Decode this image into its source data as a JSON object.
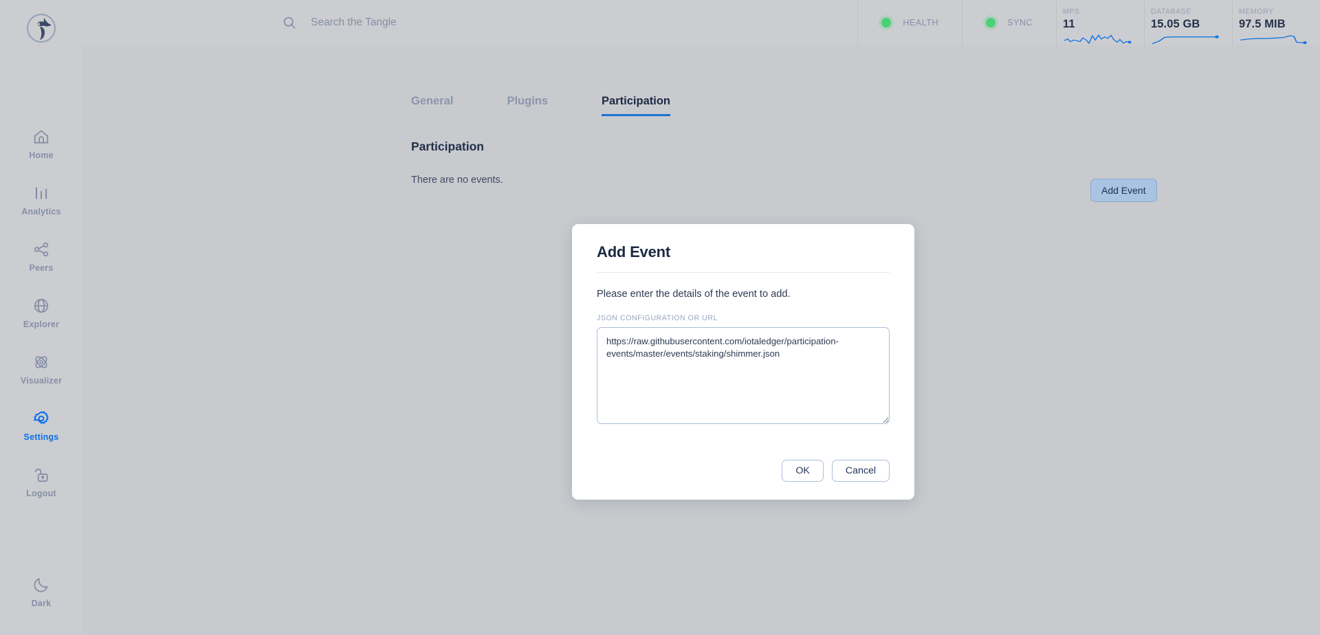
{
  "app": {
    "logo_icon": "hornet-logo-icon",
    "theme_mode_label": "Dark"
  },
  "sidebar": {
    "items": [
      {
        "label": "Home",
        "icon": "home-icon",
        "active": false
      },
      {
        "label": "Analytics",
        "icon": "bar-chart-icon",
        "active": false
      },
      {
        "label": "Peers",
        "icon": "peers-icon",
        "active": false
      },
      {
        "label": "Explorer",
        "icon": "globe-icon",
        "active": false
      },
      {
        "label": "Visualizer",
        "icon": "atom-icon",
        "active": false
      },
      {
        "label": "Settings",
        "icon": "gear-icon",
        "active": true
      },
      {
        "label": "Logout",
        "icon": "unlock-icon",
        "active": false
      }
    ],
    "theme_toggle": {
      "label": "Dark",
      "icon": "moon-icon"
    }
  },
  "header": {
    "search": {
      "icon": "search-icon",
      "placeholder": "Search the Tangle",
      "value": ""
    },
    "status": [
      {
        "label": "HEALTH",
        "icon": "status-dot-icon",
        "color": "#4cd076"
      },
      {
        "label": "SYNC",
        "icon": "status-dot-icon",
        "color": "#4cd076"
      }
    ],
    "metrics": [
      {
        "label": "MPS",
        "value": "11",
        "spark": "mps-sparkline"
      },
      {
        "label": "DATABASE",
        "value": "15.05 GB",
        "spark": "database-sparkline"
      },
      {
        "label": "MEMORY",
        "value": "97.5 MIB",
        "spark": "memory-sparkline"
      }
    ]
  },
  "main": {
    "tabs": [
      {
        "label": "General",
        "active": false
      },
      {
        "label": "Plugins",
        "active": false
      },
      {
        "label": "Participation",
        "active": true
      }
    ],
    "panel": {
      "title": "Participation",
      "empty_text": "There are no events.",
      "add_event_label": "Add Event"
    }
  },
  "dialog": {
    "title": "Add Event",
    "description": "Please enter the details of the event to add.",
    "field_label": "JSON CONFIGURATION OR URL",
    "field_value": "https://raw.githubusercontent.com/iotaledger/participation-events/master/events/staking/shimmer.json",
    "field_placeholder": "",
    "ok_label": "OK",
    "cancel_label": "Cancel"
  },
  "colors": {
    "accent": "#0c6ee9",
    "spark": "#1877e0",
    "status_ok": "#4cd076",
    "page_bg": "#c8cace",
    "sidebar_bg": "#cccdd1",
    "dialog_bg": "#ffffff",
    "text_dark": "#1d2a43",
    "text_muted": "#868fa6"
  },
  "chart_data": [
    {
      "type": "line",
      "title": "MPS",
      "name": "mps-sparkline",
      "x": [
        0,
        1,
        2,
        3,
        4,
        5,
        6,
        7,
        8,
        9,
        10,
        11,
        12,
        13,
        14,
        15,
        16,
        17,
        18,
        19,
        20,
        21,
        22
      ],
      "values": [
        10,
        12,
        9,
        11,
        10,
        9,
        13,
        11,
        7,
        15,
        11,
        16,
        12,
        14,
        13,
        16,
        12,
        9,
        12,
        7,
        9,
        9,
        8
      ],
      "ylabel": "",
      "xlabel": "",
      "grid": false,
      "legend": false
    },
    {
      "type": "line",
      "title": "DATABASE",
      "name": "database-sparkline",
      "x": [
        0,
        1,
        2,
        3,
        4,
        5,
        6,
        7,
        8,
        9,
        10
      ],
      "values": [
        0,
        4,
        9,
        14,
        15.05,
        15.05,
        15.05,
        15.05,
        15.05,
        15.05,
        15.05
      ],
      "ylabel": "GB",
      "xlabel": "",
      "grid": false,
      "legend": false
    },
    {
      "type": "line",
      "title": "MEMORY",
      "name": "memory-sparkline",
      "x": [
        0,
        1,
        2,
        3,
        4,
        5,
        6,
        7,
        8,
        9,
        10,
        11
      ],
      "values": [
        92,
        96,
        97,
        97,
        98,
        98,
        99,
        100,
        104,
        104,
        96,
        97.5
      ],
      "ylabel": "MiB",
      "xlabel": "",
      "grid": false,
      "legend": false
    }
  ]
}
